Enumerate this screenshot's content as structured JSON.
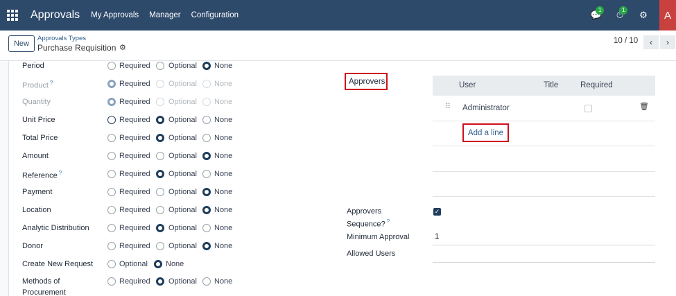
{
  "navbar": {
    "brand": "Approvals",
    "menu": [
      "My Approvals",
      "Manager",
      "Configuration"
    ],
    "messages_count": "1",
    "activities_count": "1",
    "avatar_letter": "A"
  },
  "control_panel": {
    "new_label": "New",
    "breadcrumb_parent": "Approvals Types",
    "breadcrumb_current": "Purchase Requisition",
    "pager": "10 / 10"
  },
  "options": {
    "required": "Required",
    "optional": "Optional",
    "none": "None"
  },
  "fields": [
    {
      "label": "Period",
      "selected": "none",
      "help": false,
      "muted": false
    },
    {
      "label": "Product",
      "selected": "required",
      "help": true,
      "muted": true
    },
    {
      "label": "Quantity",
      "selected": "required",
      "help": false,
      "muted": true
    },
    {
      "label": "Unit Price",
      "selected": "optional",
      "help": false,
      "muted": false
    },
    {
      "label": "Total Price",
      "selected": "optional",
      "help": false,
      "muted": false
    },
    {
      "label": "Amount",
      "selected": "none",
      "help": false,
      "muted": false
    },
    {
      "label": "Reference",
      "selected": "optional",
      "help": true,
      "muted": false
    },
    {
      "label": "Payment",
      "selected": "none",
      "help": false,
      "muted": false
    },
    {
      "label": "Location",
      "selected": "none",
      "help": false,
      "muted": false
    },
    {
      "label": "Analytic Distribution",
      "selected": "optional",
      "help": false,
      "muted": false
    },
    {
      "label": "Donor",
      "selected": "none",
      "help": false,
      "muted": false
    },
    {
      "label": "Create New Request",
      "selected": "none",
      "help": false,
      "muted": false
    },
    {
      "label": "Methods of Procurement",
      "selected": "optional",
      "help": false,
      "muted": false
    }
  ],
  "approvers": {
    "label": "Approvers",
    "columns": [
      "User",
      "Title",
      "Required"
    ],
    "rows": [
      {
        "user": "Administrator",
        "title": "",
        "required": false
      }
    ],
    "add_line": "Add a line"
  },
  "settings": {
    "sequence_label_1": "Approvers",
    "sequence_label_2": "Sequence?",
    "sequence_checked": true,
    "min_approval_label": "Minimum Approval",
    "min_approval_value": "1",
    "allowed_users_label": "Allowed Users"
  }
}
